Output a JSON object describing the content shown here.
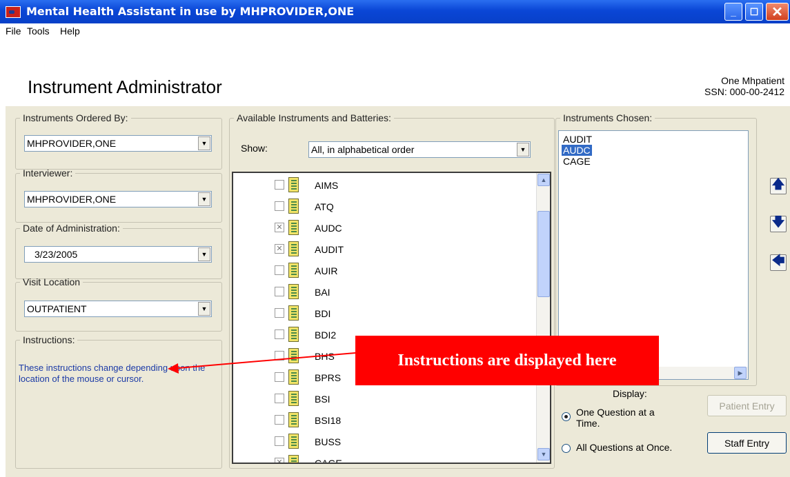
{
  "window": {
    "title": "Mental Health Assistant in use by MHPROVIDER,ONE",
    "minimize_glyph": "_",
    "maximize_glyph": "☐",
    "close_glyph": "✕"
  },
  "menu": [
    "File",
    "Tools",
    "Help"
  ],
  "header": {
    "title": "Instrument Administrator",
    "patient_name": "One Mhpatient",
    "patient_ssn": "SSN: 000-00-2412"
  },
  "left": {
    "ordered_by_label": "Instruments Ordered By:",
    "ordered_by_value": "MHPROVIDER,ONE",
    "interviewer_label": "Interviewer:",
    "interviewer_value": "MHPROVIDER,ONE",
    "date_label": "Date of Administration:",
    "date_value": "3/23/2005",
    "location_label": "Visit Location",
    "location_value": "OUTPATIENT",
    "instructions_label": "Instructions:",
    "instructions_text": "These instructions change depending upon the location of the mouse or cursor."
  },
  "available": {
    "group_label": "Available Instruments and Batteries:",
    "show_label": "Show:",
    "show_value": "All, in alphabetical order",
    "items": [
      {
        "label": "AIMS",
        "checked": false
      },
      {
        "label": "ATQ",
        "checked": false
      },
      {
        "label": "AUDC",
        "checked": true
      },
      {
        "label": "AUDIT",
        "checked": true
      },
      {
        "label": "AUIR",
        "checked": false
      },
      {
        "label": "BAI",
        "checked": false
      },
      {
        "label": "BDI",
        "checked": false
      },
      {
        "label": "BDI2",
        "checked": false
      },
      {
        "label": "BHS",
        "checked": false
      },
      {
        "label": "BPRS",
        "checked": false
      },
      {
        "label": "BSI",
        "checked": false
      },
      {
        "label": "BSI18",
        "checked": false
      },
      {
        "label": "BUSS",
        "checked": false
      },
      {
        "label": "CAGE",
        "checked": true
      }
    ]
  },
  "chosen": {
    "group_label": "Instruments Chosen:",
    "items": [
      "AUDIT",
      "AUDC",
      "CAGE"
    ],
    "selected": "AUDC"
  },
  "display": {
    "label": "Display:",
    "option_one": "One Question at a Time.",
    "option_all": "All Questions at Once.",
    "selected": "one"
  },
  "buttons": {
    "patient_entry": "Patient Entry",
    "staff_entry": "Staff Entry"
  },
  "annotation": {
    "callout": "Instructions are displayed here",
    "color": "#ff0000"
  }
}
